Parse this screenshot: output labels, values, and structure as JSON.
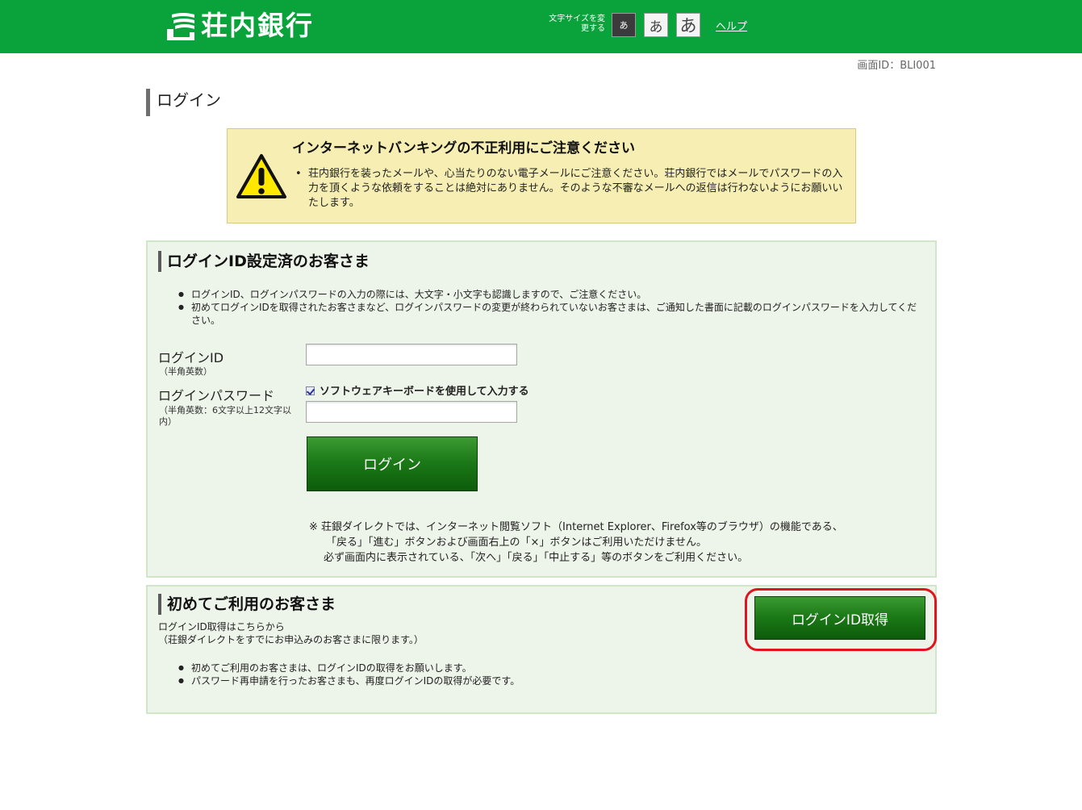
{
  "header": {
    "bank_name": "荘内銀行",
    "font_size_label": "文字サイズを変更する",
    "font_size_options": [
      "あ",
      "あ",
      "あ"
    ],
    "help_link": "ヘルプ"
  },
  "screen_id": "画面ID：BLI001",
  "page_title": "ログイン",
  "warning": {
    "title": "インターネットバンキングの不正利用にご注意ください",
    "body": "荘内銀行を装ったメールや、心当たりのない電子メールにご注意ください。荘内銀行ではメールでパスワードの入力を頂くような依頼をすることは絶対にありません。そのような不審なメールへの返信は行わないようにお願いいたします。"
  },
  "login_section": {
    "title": "ログインID設定済のお客さま",
    "notes": [
      "ログインID、ログインパスワードの入力の際には、大文字・小文字も認識しますので、ご注意ください。",
      "初めてログインIDを取得されたお客さまなど、ログインパスワードの変更が終わられていないお客さまは、ご通知した書面に記載のログインパスワードを入力してください。"
    ],
    "login_id_label": "ログインID",
    "login_id_hint": "（半角英数）",
    "login_id_value": "",
    "password_label": "ログインパスワード",
    "password_hint": "（半角英数：6文字以上12文字以内）",
    "password_value": "",
    "software_keyboard_label": "ソフトウェアキーボードを使用して入力する",
    "software_keyboard_checked": true,
    "login_button": "ログイン",
    "browser_note_lines": [
      "※ 荘銀ダイレクトでは、インターネット閲覧ソフト（Internet Explorer、Firefox等のブラウザ）の機能である、",
      "「戻る」「進む」ボタンおよび画面右上の「×」ボタンはご利用いただけません。",
      "必ず画面内に表示されている、「次へ」「戻る」「中止する」等のボタンをご利用ください。"
    ]
  },
  "first_time_section": {
    "title": "初めてご利用のお客さま",
    "description_lines": [
      "ログインID取得はこちらから",
      "（荘銀ダイレクトをすでにお申込みのお客さまに限ります。）"
    ],
    "notes": [
      "初めてご利用のお客さまは、ログインIDの取得をお願いします。",
      "パスワード再申請を行ったお客さまも、再度ログインIDの取得が必要です。"
    ],
    "get_id_button": "ログインID取得"
  },
  "colors": {
    "header_green": "#0aa23a",
    "panel_bg": "#edf4e9",
    "warning_bg": "#f6eeb2",
    "highlight_red": "#e0141e"
  }
}
